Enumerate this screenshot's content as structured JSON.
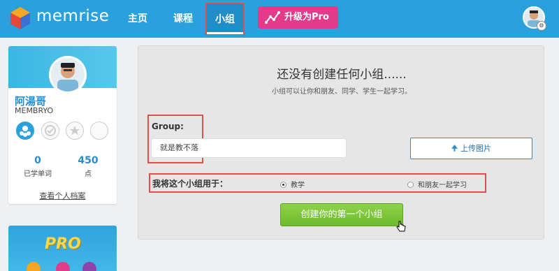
{
  "header": {
    "logo_text": "memrise",
    "nav": {
      "home": "主页",
      "courses": "课程",
      "groups": "小组"
    },
    "upgrade_label": "升级为Pro",
    "accent": "#2aa1dd",
    "upgrade_color": "#e23b8c"
  },
  "profile": {
    "name": "阿湯哥",
    "level": "MEMBRYO",
    "stats": {
      "words_value": "0",
      "words_label": "已学单词",
      "points_value": "450",
      "points_label": "点"
    },
    "view_profile": "查看个人档案"
  },
  "promo": {
    "text": "PRO"
  },
  "main": {
    "title": "还没有创建任何小组......",
    "subtitle": "小组可以让你和朋友、同学、学生一起学习。",
    "group_label": "Group:",
    "group_input_value": "就是教不落",
    "upload_label": "上传图片",
    "purpose_label": "我将这个小组用于：",
    "purpose_options": [
      {
        "label": "教学",
        "selected": true
      },
      {
        "label": "和朋友一起学习",
        "selected": false
      }
    ],
    "create_label": "创建你的第一个小组",
    "create_color": "#7cc63a",
    "highlight_color": "#e0504a"
  }
}
